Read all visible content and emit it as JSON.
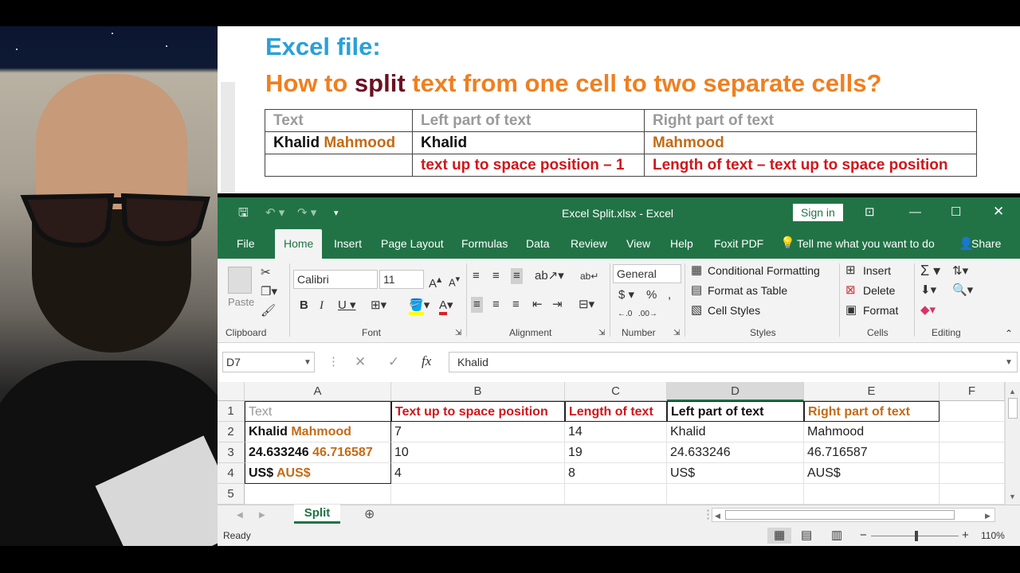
{
  "board": {
    "title_line1": "Excel file:",
    "title_line2_a": "How to ",
    "title_line2_b": "split",
    "title_line2_c": " text from one cell to two separate cells?",
    "table": {
      "h1": "Text",
      "h2": "Left part of text",
      "h3": "Right part of text",
      "r1a_1": "Khalid",
      "r1a_2": "Mahmood",
      "r1b": "Khalid",
      "r1c": "Mahmood",
      "r2b": "text up to space position – 1",
      "r2c": "Length of text – text up to space position"
    }
  },
  "excel": {
    "window_title": "Excel Split.xlsx  -  Excel",
    "sign_in": "Sign in",
    "share": "Share",
    "tell_me": "Tell me what you want to do",
    "tabs": [
      "File",
      "Home",
      "Insert",
      "Page Layout",
      "Formulas",
      "Data",
      "Review",
      "View",
      "Help",
      "Foxit PDF"
    ],
    "ribbon": {
      "paste": "Paste",
      "font_name": "Calibri",
      "font_size": "11",
      "number_format": "General",
      "conditional_formatting": "Conditional Formatting",
      "format_as_table": "Format as Table",
      "cell_styles": "Cell Styles",
      "insert": "Insert",
      "delete": "Delete",
      "format": "Format",
      "groups": [
        "Clipboard",
        "Font",
        "Alignment",
        "Number",
        "Styles",
        "Cells",
        "Editing"
      ]
    },
    "name_box": "D7",
    "formula_value": "Khalid",
    "columns": [
      "A",
      "B",
      "C",
      "D",
      "E",
      "F"
    ],
    "rows": [
      "1",
      "2",
      "3",
      "4",
      "5"
    ],
    "cells": {
      "a1": "Text",
      "b1": "Text up to space position",
      "c1": "Length of text",
      "d1": "Left part of text",
      "e1": "Right part of text",
      "a2_1": "Khalid",
      "a2_2": "Mahmood",
      "b2": "7",
      "c2": "14",
      "d2": "Khalid",
      "e2": "Mahmood",
      "a3_1": "24.633246",
      "a3_2": "46.716587",
      "b3": "10",
      "c3": "19",
      "d3": "24.633246",
      "e3": "46.716587",
      "a4_1": "US$",
      "a4_2": "AUS$",
      "b4": "4",
      "c4": "8",
      "d4": "US$",
      "e4": "AUS$"
    },
    "sheet_tab": "Split",
    "status_ready": "Ready",
    "zoom": "110%"
  },
  "colors": {
    "excel_green": "#217346",
    "title_blue": "#2aa0d8",
    "title_orange": "#f07f1f",
    "accent_red": "#d0161b",
    "accent_brown": "#c36b16"
  }
}
